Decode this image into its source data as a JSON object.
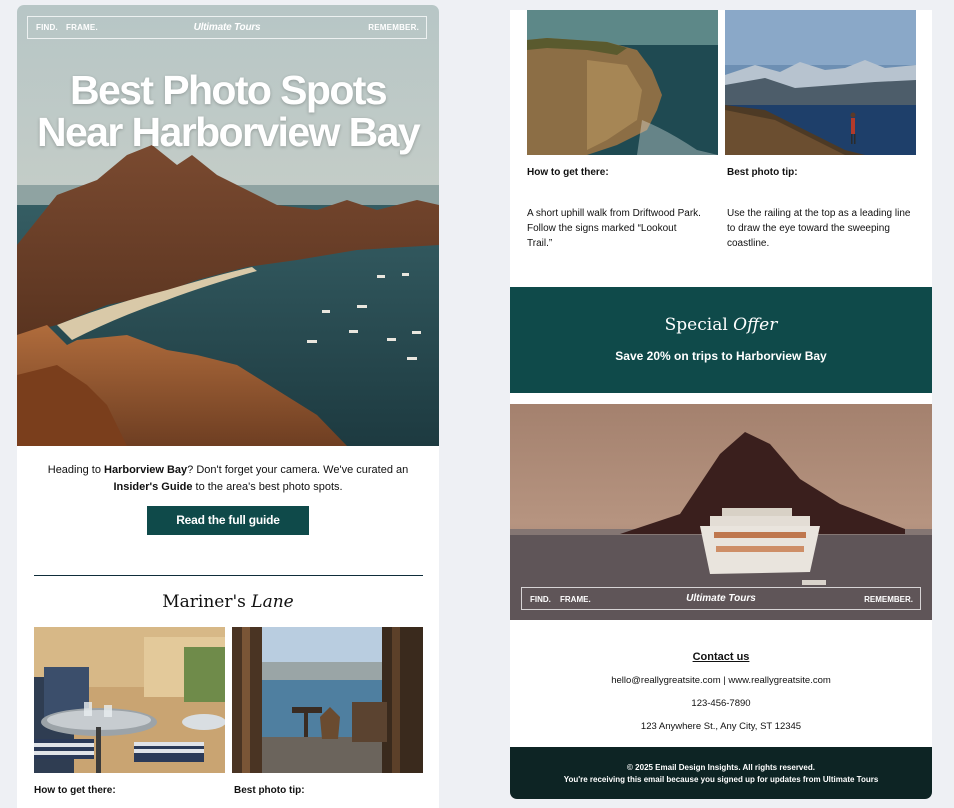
{
  "brand": {
    "nav_left_1": "FIND.",
    "nav_left_2": "FRAME.",
    "name": "Ultimate Tours",
    "nav_right": "REMEMBER."
  },
  "hero": {
    "title_line1": "Best Photo Spots",
    "title_line2": "Near Harborview Bay"
  },
  "intro": {
    "text_1": "Heading to ",
    "bold_1": "Harborview Bay",
    "text_2": "? Don't forget your camera. We've curated an ",
    "bold_2": "Insider's Guide",
    "text_3": " to the area's best photo spots."
  },
  "cta": {
    "label": "Read the full guide"
  },
  "section": {
    "title_plain": "Mariner's ",
    "title_italic": "Lane"
  },
  "left_captions": {
    "how_heading": "How to get there:",
    "tip_heading": "Best photo tip:"
  },
  "right_captions": {
    "how_heading": "How to get there:",
    "how_text": "A short uphill walk from Driftwood Park. Follow the signs marked “Lookout Trail.”",
    "tip_heading": "Best photo tip:",
    "tip_text": "Use the railing at the top as a leading line to draw the eye toward the sweeping coastline."
  },
  "offer": {
    "title_plain": "Special ",
    "title_italic": "Offer",
    "subtitle": "Save 20% on trips to Harborview Bay"
  },
  "contact": {
    "title": "Contact us",
    "email_web": "hello@reallygreatsite.com  |  www.reallygreatsite.com",
    "phone": "123-456-7890",
    "address": "123 Anywhere St., Any City, ST 12345"
  },
  "footer": {
    "copyright": "© 2025 Email Design Insights. All rights reserved.",
    "notice": "You're receiving this email because you signed up for updates from Ultimate Tours"
  },
  "colors": {
    "accent_teal": "#0f4a4a",
    "footer_dark": "#0d2424",
    "page_bg": "#eef0f4"
  }
}
